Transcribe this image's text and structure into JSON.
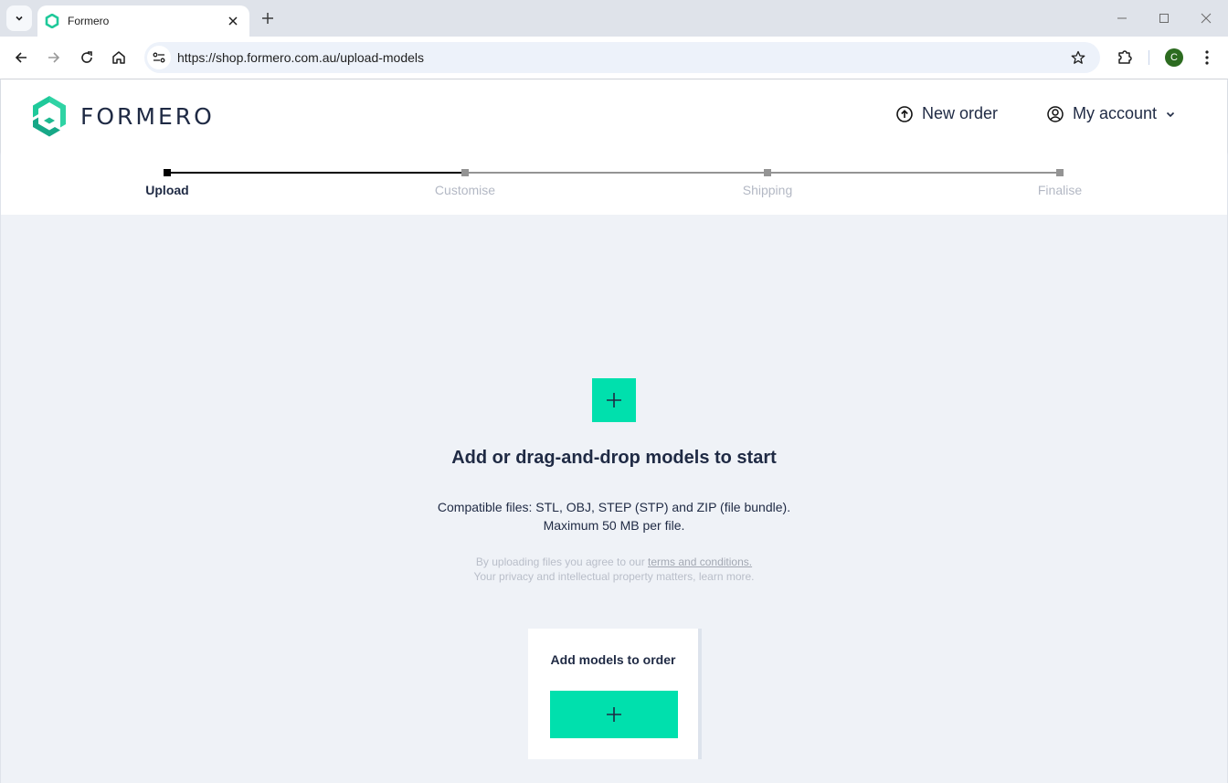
{
  "browser": {
    "tab_title": "Formero",
    "url": "https://shop.formero.com.au/upload-models",
    "profile_initial": "C",
    "icons": {
      "tab_search": "chevron-down-icon",
      "tab_close": "close-icon",
      "new_tab": "plus-icon",
      "back": "arrow-left-icon",
      "forward": "arrow-right-icon",
      "reload": "reload-icon",
      "home": "home-icon",
      "site_info": "tune-icon",
      "bookmark": "star-icon",
      "extensions": "puzzle-icon",
      "menu": "kebab-menu-icon",
      "minimize": "minimize-icon",
      "maximize": "maximize-icon",
      "close": "close-icon"
    },
    "colors": {
      "profile": "#2c6b20"
    }
  },
  "header": {
    "logo_text": "FORMERO",
    "new_order_label": "New order",
    "my_account_label": "My account"
  },
  "stepper": {
    "current_step": 1,
    "progress_fraction": 0.33,
    "steps": [
      {
        "label": "Upload",
        "state": "active"
      },
      {
        "label": "Customise",
        "state": "upcoming"
      },
      {
        "label": "Shipping",
        "state": "upcoming"
      },
      {
        "label": "Finalise",
        "state": "upcoming"
      }
    ]
  },
  "upload": {
    "title": "Add or drag-and-drop models to start",
    "compat_line1": "Compatible files: STL, OBJ, STEP (STP) and ZIP (file bundle).",
    "compat_line2": "Maximum 50 MB per file.",
    "legal_prefix": "By uploading files you agree to our ",
    "legal_link": "terms and conditions.",
    "legal_line2": "Your privacy and intellectual property matters, learn more."
  },
  "card": {
    "title": "Add models to order"
  },
  "colors": {
    "accent": "#00e0ad",
    "text_primary": "#1f2a44",
    "page_bg": "#eff2f7",
    "logo_green": "#1fc99a"
  }
}
